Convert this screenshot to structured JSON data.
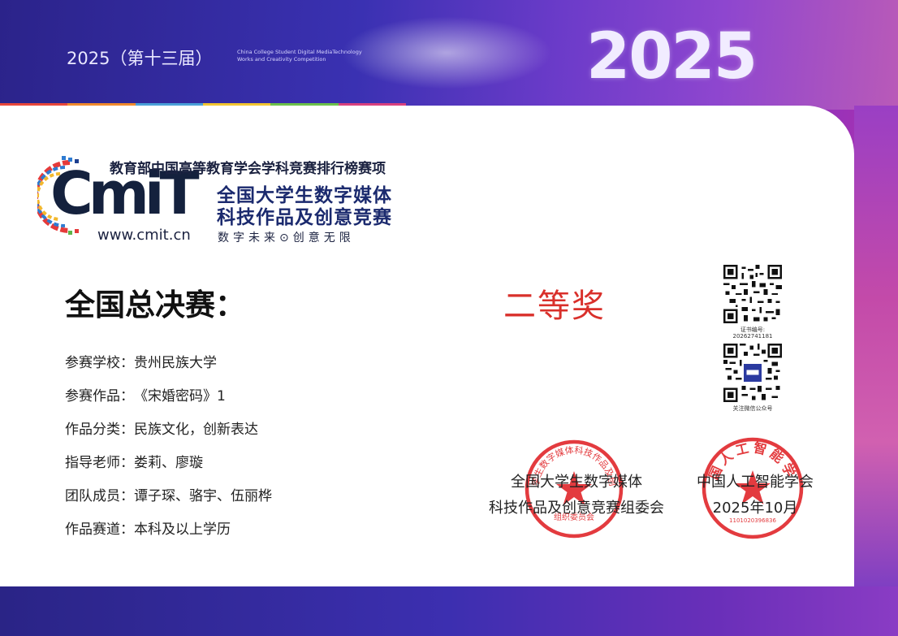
{
  "header": {
    "edition": "2025（第十三届）",
    "english_subtitle": "China College Student Digital MediaTechnology Works and Creativity Competition",
    "year_graphic": "2025"
  },
  "logo": {
    "top_line": "教育部中国高等教育学会学科竞赛排行榜赛项",
    "mark": "CmiT",
    "name_line1": "全国大学生数字媒体",
    "name_line2": "科技作品及创意竞赛",
    "website": "www.cmit.cn",
    "slogan": "数字未来⊙创意无限"
  },
  "award": {
    "stage": "全国总决赛：",
    "level": "二等奖"
  },
  "fields": [
    {
      "label": "参赛学校：",
      "value": "贵州民族大学"
    },
    {
      "label": "参赛作品：",
      "value": "《宋婚密码》1"
    },
    {
      "label": "作品分类：",
      "value": "民族文化，创新表达"
    },
    {
      "label": "指导老师：",
      "value": "娄莉、廖璇"
    },
    {
      "label": "团队成员：",
      "value": "谭子琛、骆宇、伍丽桦"
    },
    {
      "label": "作品赛道：",
      "value": "本科及以上学历"
    }
  ],
  "certificate": {
    "number_label": "证书编号:",
    "number": "20262741181",
    "follow_label": "关注微信公众号"
  },
  "issuers": {
    "org1_line1": "全国大学生数字媒体",
    "org1_line2": "科技作品及创意竞赛组委会",
    "org2_line1": "中国人工智能学会",
    "org2_line2": "2025年10月"
  },
  "seals": {
    "seal1_text": "全国大学生数字媒体科技作品及创意竞赛",
    "seal1_bottom": "组织委员会",
    "seal2_text": "中国人工智能学会",
    "seal2_bottom": "1101020396836"
  },
  "colors": {
    "award_red": "#d9302b",
    "seal_red": "#e0262a",
    "band_blue": "#3327a0",
    "band_purple": "#8c2fbd"
  }
}
